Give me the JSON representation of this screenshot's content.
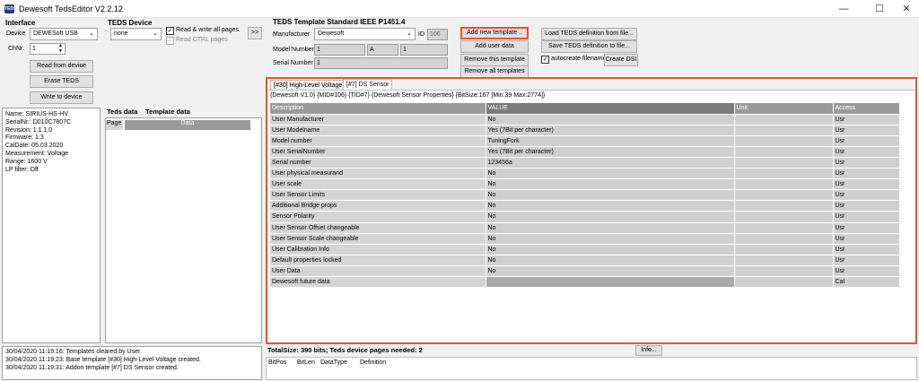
{
  "window": {
    "title": "Dewesoft TedsEditor V2.2.12",
    "icon_text": "TEDS",
    "minimize": "—",
    "maximize": "☐",
    "close": "✕"
  },
  "interface": {
    "title": "Interface",
    "device_label": "Device",
    "device_value": "DEWESoft USB",
    "chnr_label": "ChNr.",
    "chnr_value": "1",
    "read_button": "Read from device",
    "erase_button": "Erase TEDS",
    "write_button": "Write to device"
  },
  "teds_device": {
    "title": "TEDS Device",
    "select_value": "none",
    "read_write_all": "Read & write all pages",
    "read_ctrl": "Read CTRL pages",
    "transfer_button": ">>"
  },
  "template_std": {
    "title": "TEDS Template Standard IEEE P1451.4",
    "manufacturer_label": "Manufacturer",
    "manufacturer_value": "Dewesoft",
    "id_label": "ID",
    "id_value": "106",
    "model_label": "Model Number",
    "model_value": "1",
    "a_label": "A",
    "version_value": "1",
    "serial_label": "Serial Number",
    "serial_value": "1"
  },
  "template_buttons": {
    "add_new": "Add new template ..",
    "add_user": "Add user data",
    "remove_this": "Remove this template",
    "remove_all": "Remove all templates",
    "load": "Load TEDS definition from file...",
    "save": "Save TEDS definition to file...",
    "autocreate": "autocreate filename",
    "create_dsi": "Create DSI"
  },
  "device_info": [
    "Name: SIRIUS-HS-HV",
    "SerialNr.: D010C7807C",
    "Revision: 1.1.1.0",
    "Firmware: 1.3",
    "CalDate: 05.03.2020",
    "Measurement: Voltage",
    "Range: 1600 V",
    "LP filter: Off"
  ],
  "left_tabs": {
    "teds_data": "Teds data",
    "template_data": "Template data",
    "col_page": "Page",
    "col_data": "Data"
  },
  "right_tabs": [
    {
      "label": "[#30] High-Level Voltage"
    },
    {
      "label": "[#7] DS Sensor"
    }
  ],
  "sensor_header": "{Dewesoft V1.0} {MID#106} {TID#7} {Dewesoft Sensor Properties} {BitSize:167 [Min:39 Max:2774]}",
  "grid": {
    "headers": [
      "Description",
      "VALUE",
      "Unit",
      "Access"
    ],
    "rows": [
      {
        "d": "User Manufacturer",
        "v": "No",
        "u": "",
        "a": "Usr"
      },
      {
        "d": "User Modelname",
        "v": "Yes (7Bit per character)",
        "u": "",
        "a": "Usr"
      },
      {
        "d": "Model number",
        "v": "TuningFork",
        "u": "",
        "a": "Usr"
      },
      {
        "d": "User SerialNumber",
        "v": "Yes (7Bit per character)",
        "u": "",
        "a": "Usr"
      },
      {
        "d": "Serial number",
        "v": "123456a",
        "u": "",
        "a": "Usr"
      },
      {
        "d": "User physical measurand",
        "v": "No",
        "u": "",
        "a": "Usr"
      },
      {
        "d": "User scale",
        "v": "No",
        "u": "",
        "a": "Usr"
      },
      {
        "d": "User Sensor Limits",
        "v": "No",
        "u": "",
        "a": "Usr"
      },
      {
        "d": "Additional Bridge props",
        "v": "No",
        "u": "",
        "a": "Usr"
      },
      {
        "d": "Sensor Polarity",
        "v": "No",
        "u": "",
        "a": "Usr"
      },
      {
        "d": "User Sensor Offset changeable",
        "v": "No",
        "u": "",
        "a": "Usr"
      },
      {
        "d": "User Sensor Scale changeable",
        "v": "No",
        "u": "",
        "a": "Usr"
      },
      {
        "d": "User Calibration Info",
        "v": "No",
        "u": "",
        "a": "Usr"
      },
      {
        "d": "Default properties locked",
        "v": "No",
        "u": "",
        "a": "Usr"
      },
      {
        "d": "User Data",
        "v": "No",
        "u": "",
        "a": "Usr"
      },
      {
        "d": "Dewesoft future data",
        "v": "",
        "u": "",
        "a": "Cal"
      }
    ]
  },
  "log": [
    "30/04/2020 11:19:16: Templates cleared by User.",
    "30/04/2020 11:19:23: Base template [#30] High-Level Voltage created.",
    "30/04/2020 11:19:31: Addon template [#7] DS Sensor created."
  ],
  "total": {
    "text": "TotalSize: 390 bits; Teds device pages needed: 2",
    "info_button": "Info...",
    "cols": [
      "BitPos",
      "BitLen",
      "DataType",
      "Definition"
    ]
  },
  "colors": {
    "highlight": "#e8542d"
  }
}
